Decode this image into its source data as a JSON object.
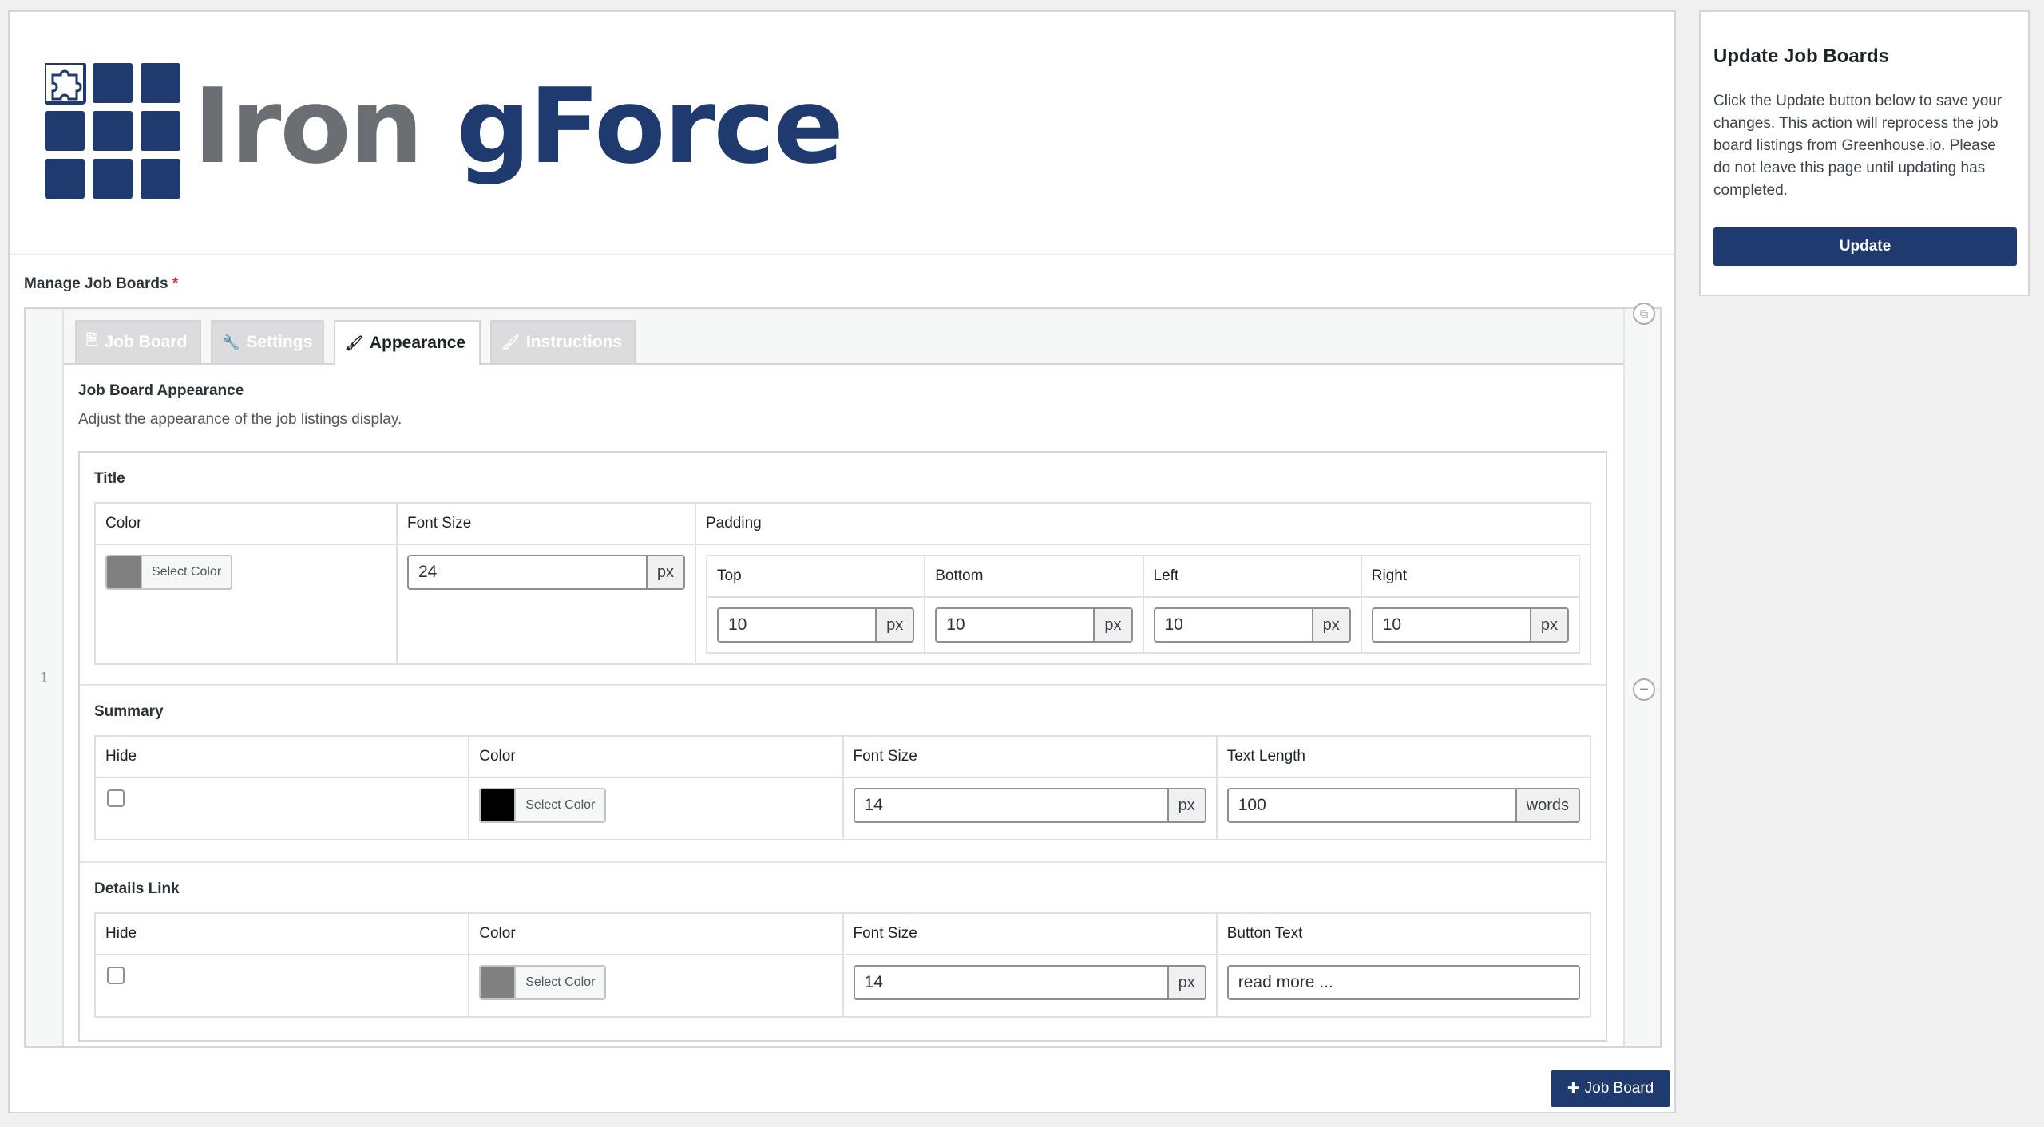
{
  "logo": {
    "word1": "Iron",
    "word2": "gForce"
  },
  "manage": {
    "label": "Manage Job Boards",
    "required_mark": "*"
  },
  "row": {
    "index": "1"
  },
  "tabs": [
    {
      "label": "Job Board",
      "icon": "document-icon"
    },
    {
      "label": "Settings",
      "icon": "wrench-icon"
    },
    {
      "label": "Appearance",
      "icon": "paintbrush-icon",
      "active": true
    },
    {
      "label": "Instructions",
      "icon": "paintbrush-icon"
    }
  ],
  "appearance": {
    "title": "Job Board Appearance",
    "description": "Adjust the appearance of the job listings display."
  },
  "title_group": {
    "label": "Title",
    "color_header": "Color",
    "font_size_header": "Font Size",
    "padding_header": "Padding",
    "color_button": "Select Color",
    "swatch": "#808080",
    "font_size": "24",
    "unit": "px",
    "padding": {
      "top_label": "Top",
      "bottom_label": "Bottom",
      "left_label": "Left",
      "right_label": "Right",
      "top": "10",
      "bottom": "10",
      "left": "10",
      "right": "10"
    }
  },
  "summary_group": {
    "label": "Summary",
    "hide_header": "Hide",
    "color_header": "Color",
    "font_size_header": "Font Size",
    "text_length_header": "Text Length",
    "color_button": "Select Color",
    "swatch": "#000000",
    "font_size": "14",
    "unit": "px",
    "text_length": "100",
    "text_length_unit": "words"
  },
  "details_group": {
    "label": "Details Link",
    "hide_header": "Hide",
    "color_header": "Color",
    "font_size_header": "Font Size",
    "button_text_header": "Button Text",
    "color_button": "Select Color",
    "swatch": "#808080",
    "font_size": "14",
    "unit": "px",
    "button_text": "read more ..."
  },
  "add_button": {
    "label": "Job Board",
    "icon": "plus-icon"
  },
  "side": {
    "title": "Update Job Boards",
    "text": "Click the Update button below to save your changes. This action will reprocess the job board listings from Greenhouse.io. Please do not leave this page until updating has completed.",
    "button": "Update"
  }
}
